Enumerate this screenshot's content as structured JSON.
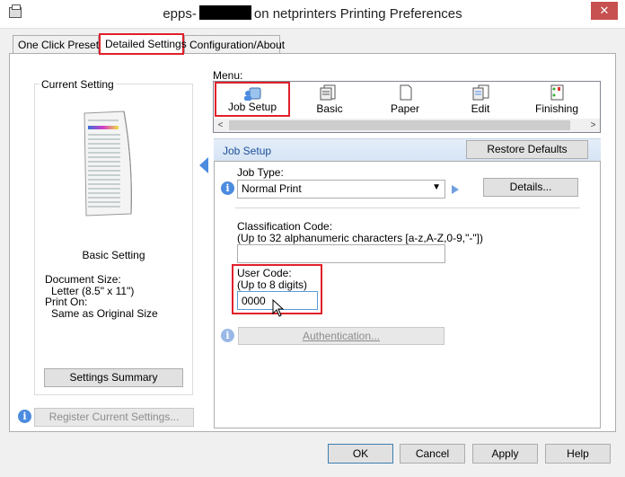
{
  "window": {
    "title_prefix": "epps-",
    "title_suffix": "on netprinters Printing Preferences",
    "close_glyph": "✕"
  },
  "tabs": [
    {
      "label": "One Click Presets"
    },
    {
      "label": "Detailed Settings"
    },
    {
      "label": "Configuration/About"
    }
  ],
  "current_setting": {
    "group_label": "Current Setting",
    "preset_name": "Basic Setting",
    "document_size_label": "Document Size:",
    "document_size_value": "Letter (8.5\" x 11\")",
    "print_on_label": "Print On:",
    "print_on_value": "Same as Original Size",
    "summary_button": "Settings Summary"
  },
  "register_button": "Register Current Settings...",
  "menu": {
    "label": "Menu:",
    "items": [
      {
        "label": "Job Setup",
        "icon": "job-setup-icon"
      },
      {
        "label": "Basic",
        "icon": "basic-icon"
      },
      {
        "label": "Paper",
        "icon": "paper-icon"
      },
      {
        "label": "Edit",
        "icon": "edit-icon"
      },
      {
        "label": "Finishing",
        "icon": "finishing-icon"
      }
    ]
  },
  "job_setup": {
    "header": "Job Setup",
    "restore_defaults": "Restore Defaults",
    "job_type_label": "Job Type:",
    "job_type_value": "Normal Print",
    "details_button": "Details...",
    "classification_label": "Classification Code:",
    "classification_hint": "(Up to 32 alphanumeric characters [a-z,A-Z,0-9,\"-\"])",
    "classification_value": "",
    "user_code_label": "User Code:",
    "user_code_hint": "(Up to 8 digits)",
    "user_code_value": "0000",
    "authentication_button": "Authentication..."
  },
  "footer": {
    "ok": "OK",
    "cancel": "Cancel",
    "apply": "Apply",
    "help": "Help"
  },
  "colors": {
    "highlight": "#e0202a",
    "accent": "#4b8be0"
  }
}
